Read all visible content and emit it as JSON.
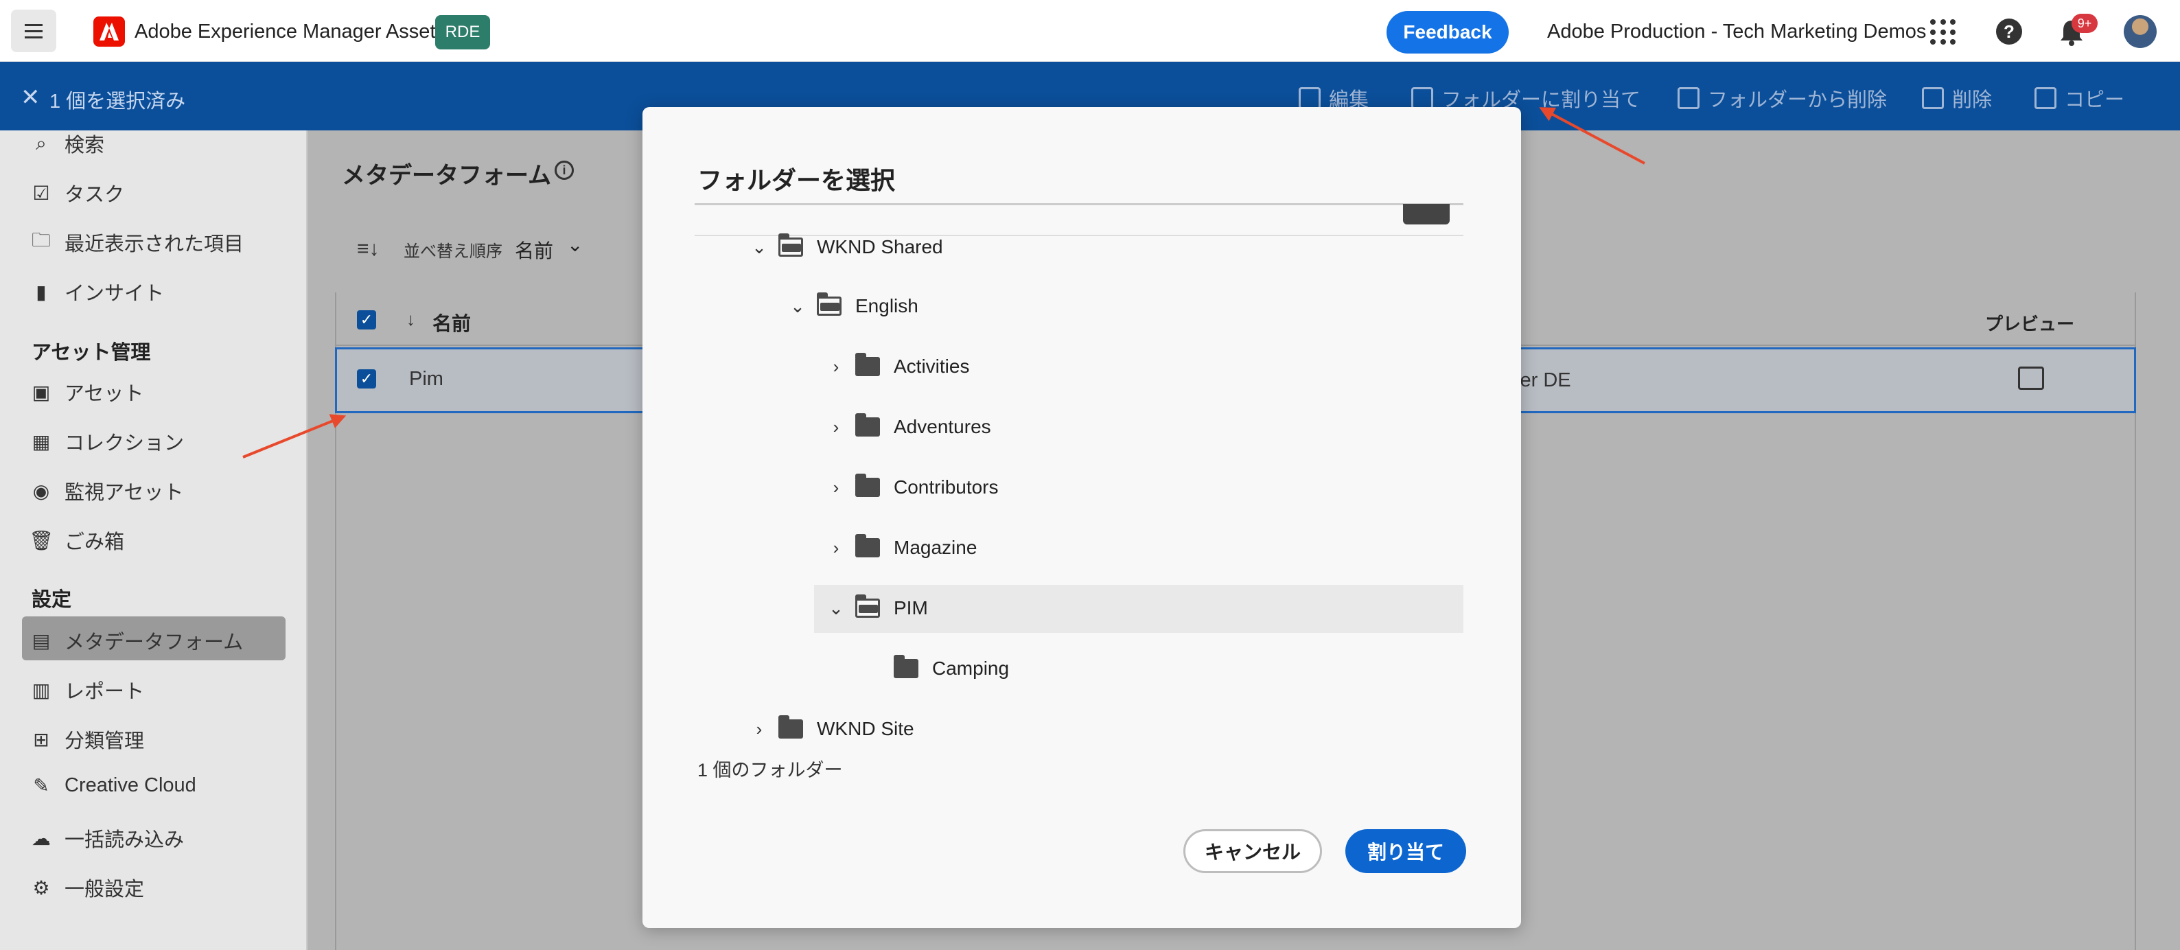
{
  "topbar": {
    "app_title": "Adobe Experience Manager Assets",
    "env_badge": "RDE",
    "feedback_label": "Feedback",
    "org_name": "Adobe Production - Tech Marketing Demos",
    "notification_count": "9+"
  },
  "selection_bar": {
    "close_glyph": "✕",
    "count_label": "1 個を選択済み",
    "actions": [
      {
        "label": "編集",
        "icon": "edit-icon"
      },
      {
        "label": "フォルダーに割り当て",
        "icon": "assign-folder-icon"
      },
      {
        "label": "フォルダーから削除",
        "icon": "remove-folder-icon"
      },
      {
        "label": "削除",
        "icon": "trash-icon"
      },
      {
        "label": "コピー",
        "icon": "copy-icon"
      }
    ]
  },
  "sidebar": {
    "items_top": [
      {
        "label": "検索",
        "icon": "search-icon"
      },
      {
        "label": "タスク",
        "icon": "tasks-icon"
      },
      {
        "label": "最近表示された項目",
        "icon": "recent-icon"
      },
      {
        "label": "インサイト",
        "icon": "insights-icon"
      }
    ],
    "section_assets": "アセット管理",
    "items_assets": [
      {
        "label": "アセット",
        "icon": "assets-icon"
      },
      {
        "label": "コレクション",
        "icon": "collections-icon"
      },
      {
        "label": "監視アセット",
        "icon": "eye-icon"
      },
      {
        "label": "ごみ箱",
        "icon": "trash-icon"
      }
    ],
    "section_settings": "設定",
    "items_settings": [
      {
        "label": "メタデータフォーム",
        "icon": "metadata-form-icon"
      },
      {
        "label": "レポート",
        "icon": "report-icon"
      },
      {
        "label": "分類管理",
        "icon": "taxonomy-icon"
      },
      {
        "label": "Creative Cloud",
        "icon": "brush-icon"
      },
      {
        "label": "一括読み込み",
        "icon": "upload-icon"
      },
      {
        "label": "一般設定",
        "icon": "gear-icon"
      }
    ]
  },
  "main": {
    "page_title": "メタデータフォーム",
    "sort_label": "並べ替え順序",
    "sort_value": "名前",
    "columns": {
      "name": "名前",
      "preview": "プレビュー"
    },
    "rows": [
      {
        "name": "Pim",
        "user": "ser DE"
      }
    ]
  },
  "dialog": {
    "title": "フォルダーを選択",
    "tree": [
      {
        "label": "WKND Shared",
        "expanded": true
      },
      {
        "label": "English",
        "expanded": true
      },
      {
        "label": "Activities",
        "expanded": false
      },
      {
        "label": "Adventures",
        "expanded": false
      },
      {
        "label": "Contributors",
        "expanded": false
      },
      {
        "label": "Magazine",
        "expanded": false
      },
      {
        "label": "PIM",
        "expanded": true,
        "selected": true
      },
      {
        "label": "Camping",
        "expanded": false
      },
      {
        "label": "WKND Site",
        "expanded": false
      }
    ],
    "folder_count": "1 個のフォルダー",
    "cancel_label": "キャンセル",
    "assign_label": "割り当て"
  },
  "colors": {
    "accent_blue": "#1473e6",
    "selection_bar": "#0b4f9a",
    "annotation_arrow": "#e8492c"
  }
}
